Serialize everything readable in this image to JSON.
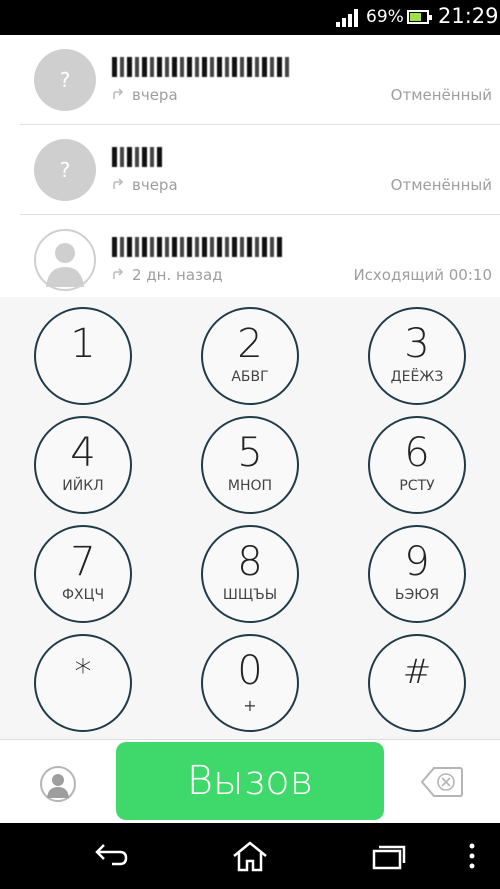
{
  "status_bar": {
    "battery_percent": "69%",
    "battery_level": 0.69,
    "time": "21:29"
  },
  "call_log": [
    {
      "avatar": "?",
      "time": "вчера",
      "status": "Отменённый"
    },
    {
      "avatar": "?",
      "time": "вчера",
      "status": "Отменённый"
    },
    {
      "avatar": "",
      "time": "2 дн. назад",
      "status": "Исходящий 00:10"
    }
  ],
  "keypad": [
    {
      "digit": "1",
      "letters": ""
    },
    {
      "digit": "2",
      "letters": "АБВГ"
    },
    {
      "digit": "3",
      "letters": "ДЕЁЖЗ"
    },
    {
      "digit": "4",
      "letters": "ИЙКЛ"
    },
    {
      "digit": "5",
      "letters": "МНОП"
    },
    {
      "digit": "6",
      "letters": "РСТУ"
    },
    {
      "digit": "7",
      "letters": "ФХЦЧ"
    },
    {
      "digit": "8",
      "letters": "ШЩЪЫ"
    },
    {
      "digit": "9",
      "letters": "ЬЭЮЯ"
    },
    {
      "digit": "*",
      "letters": ""
    },
    {
      "digit": "0",
      "letters": "+"
    },
    {
      "digit": "#",
      "letters": ""
    }
  ],
  "actions": {
    "call_label": "Вызов"
  },
  "colors": {
    "call_button": "#3fd86a",
    "key_border": "#1f3b49"
  },
  "icons": {
    "contacts": "person-icon",
    "backspace": "backspace-icon",
    "nav_back": "back-arrow-icon",
    "nav_home": "home-icon",
    "nav_recents": "recent-apps-icon",
    "nav_menu": "overflow-menu-icon"
  }
}
